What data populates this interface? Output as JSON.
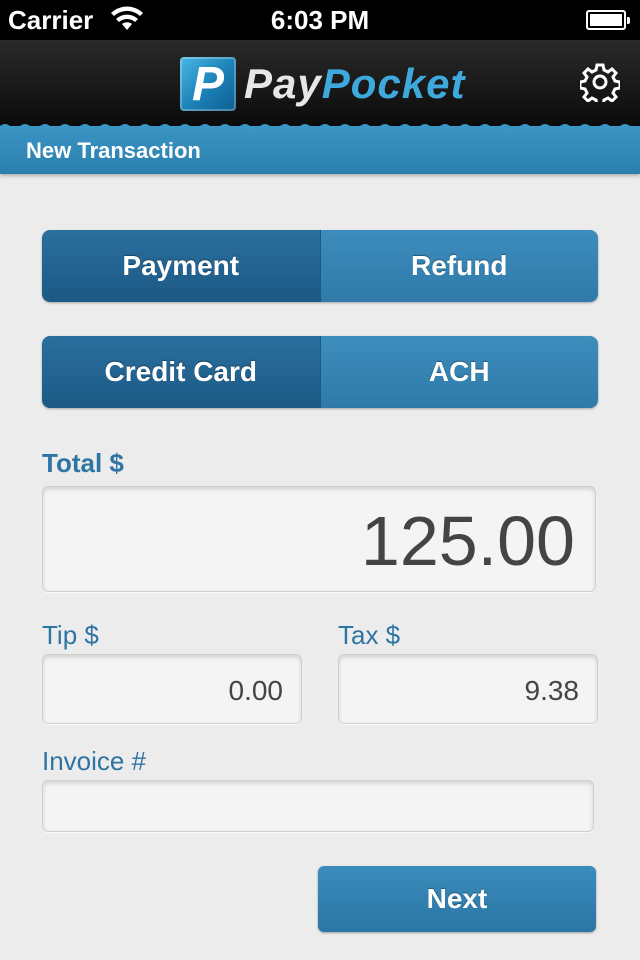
{
  "status_bar": {
    "carrier": "Carrier",
    "time": "6:03 PM",
    "wifi_icon": "wifi-icon",
    "battery_icon": "battery-icon",
    "battery_level": 1.0
  },
  "nav_bar": {
    "logo_mark": "P",
    "logo_text_part1": "Pay",
    "logo_text_part2": "Pocket",
    "settings_icon": "gear-icon"
  },
  "section_header": {
    "title": "New Transaction"
  },
  "transaction_type": {
    "options": [
      {
        "label": "Payment",
        "selected": true
      },
      {
        "label": "Refund",
        "selected": false
      }
    ]
  },
  "payment_method": {
    "options": [
      {
        "label": "Credit Card",
        "selected": true
      },
      {
        "label": "ACH",
        "selected": false
      }
    ]
  },
  "form": {
    "total_label": "Total $",
    "total_value": "125.00",
    "tip_label": "Tip $",
    "tip_value": "0.00",
    "tax_label": "Tax $",
    "tax_value": "9.38",
    "invoice_label": "Invoice #",
    "invoice_value": ""
  },
  "actions": {
    "next_label": "Next"
  },
  "colors": {
    "accent": "#2f7aa9",
    "accent_selected": "#1c5985",
    "label": "#2f75a3",
    "logo_pocket": "#3ea9dc"
  }
}
